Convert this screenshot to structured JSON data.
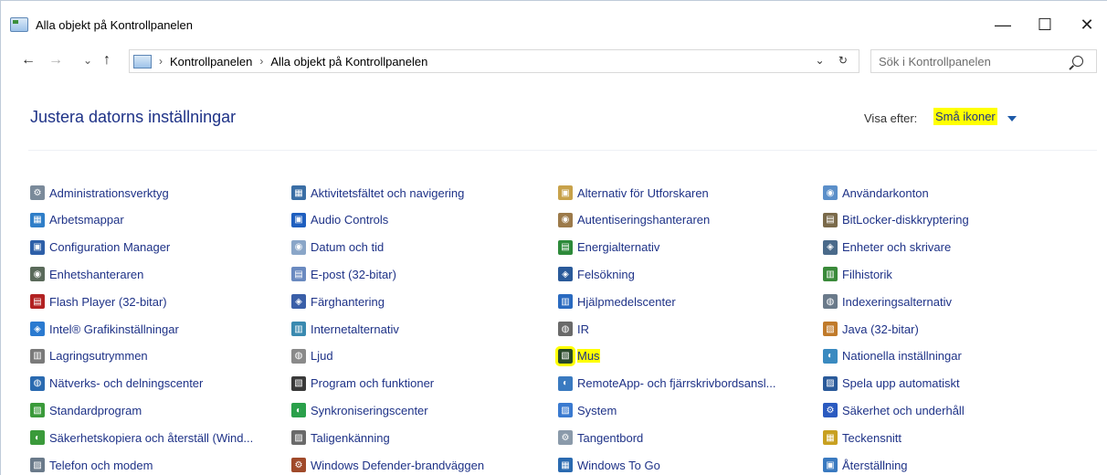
{
  "window": {
    "title": "Alla objekt på Kontrollpanelen",
    "minimize": "—",
    "maximize": "☐",
    "close": "✕"
  },
  "nav": {
    "back": "←",
    "forward": "→",
    "recent": "⌄",
    "up": "↑",
    "refresh": "⌄ ↻"
  },
  "address": {
    "crumbs": [
      "Kontrollpanelen",
      "Alla objekt på Kontrollpanelen"
    ],
    "sep": "›"
  },
  "search": {
    "placeholder": "Sök i Kontrollpanelen"
  },
  "content": {
    "heading": "Justera datorns inställningar",
    "view_by_label": "Visa efter:",
    "view_by_value": "Små ikoner"
  },
  "items": [
    [
      "Administrationsverktyg",
      "Aktivitetsfältet och navigering",
      "Alternativ för Utforskaren",
      "Användarkonton"
    ],
    [
      "Arbetsmappar",
      "Audio Controls",
      "Autentiseringshanteraren",
      "BitLocker-diskkryptering"
    ],
    [
      "Configuration Manager",
      "Datum och tid",
      "Energialternativ",
      "Enheter och skrivare"
    ],
    [
      "Enhetshanteraren",
      "E-post (32-bitar)",
      "Felsökning",
      "Filhistorik"
    ],
    [
      "Flash Player (32-bitar)",
      "Färghantering",
      "Hjälpmedelscenter",
      "Indexeringsalternativ"
    ],
    [
      "Intel® Grafikinställningar",
      "Internetalternativ",
      "IR",
      "Java (32-bitar)"
    ],
    [
      "Lagringsutrymmen",
      "Ljud",
      "Mus",
      "Nationella inställningar"
    ],
    [
      "Nätverks- och delningscenter",
      "Program och funktioner",
      "RemoteApp- och fjärrskrivbordsansl...",
      "Spela upp automatiskt"
    ],
    [
      "Standardprogram",
      "Synkroniseringscenter",
      "System",
      "Säkerhet och underhåll"
    ],
    [
      "Säkerhetskopiera och återställ (Wind...",
      "Taligenkänning",
      "Tangentbord",
      "Teckensnitt"
    ],
    [
      "Telefon och modem",
      "Windows Defender-brandväggen",
      "Windows To Go",
      "Återställning"
    ]
  ],
  "icon_colors": [
    [
      "#7a8a9a",
      "#3a6ea5",
      "#c8a24a",
      "#5b8fc9"
    ],
    [
      "#2f7ec8",
      "#1f5fbf",
      "#9c7a4a",
      "#7a6a4a"
    ],
    [
      "#2d5fa8",
      "#8aa6c8",
      "#2d8a3a",
      "#4a6a8a"
    ],
    [
      "#5a6a5a",
      "#6a8ac0",
      "#2a5a9a",
      "#3a8a3a"
    ],
    [
      "#b22222",
      "#3a5fa8",
      "#2a6ac0",
      "#6a7a8a"
    ],
    [
      "#2a7ad0",
      "#3a8ab0",
      "#6a6a6a",
      "#c07a2a"
    ],
    [
      "#7a7a7a",
      "#8a8a8a",
      "#2a4a2a",
      "#3a8ac0"
    ],
    [
      "#2a6ab0",
      "#3a3a3a",
      "#3a7ac0",
      "#2a5a9a"
    ],
    [
      "#3a9a3a",
      "#2aa04a",
      "#3a7ad0",
      "#2a5ac0"
    ],
    [
      "#3a9a3a",
      "#6a6a6a",
      "#8a9aaa",
      "#c8a020"
    ],
    [
      "#6a7a8a",
      "#a04a2a",
      "#2a6ab0",
      "#3a7ac0"
    ]
  ],
  "highlight_color": "#ffff00",
  "link_color": "#1e3287"
}
